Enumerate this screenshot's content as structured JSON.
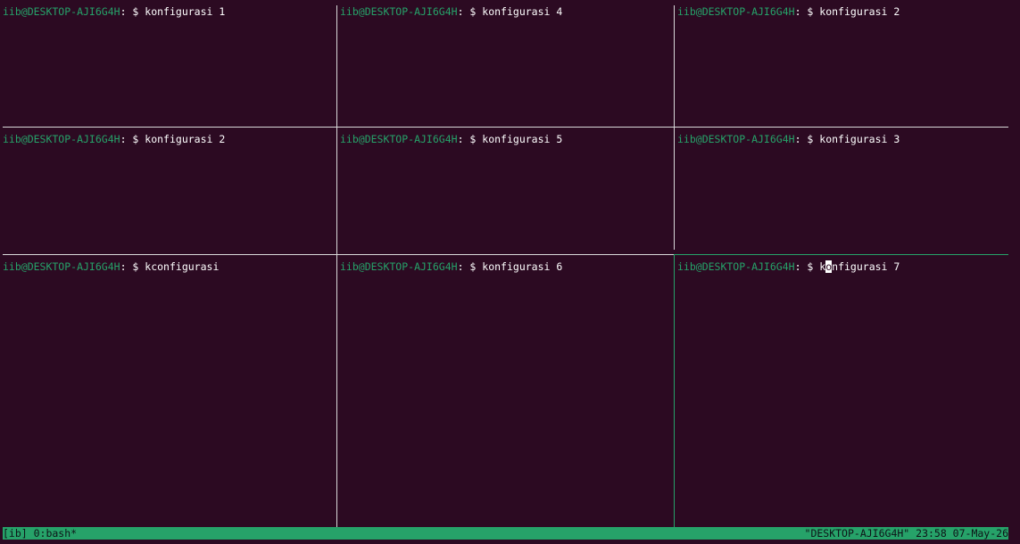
{
  "prompt": {
    "user_host": "iib@DESKTOP-AJI6G4H",
    "separator": ":",
    "symbol": " $ "
  },
  "panes": [
    {
      "command": "konfigurasi 1"
    },
    {
      "command": "konfigurasi 4"
    },
    {
      "command": "konfigurasi 2"
    },
    {
      "command": "konfigurasi 2"
    },
    {
      "command": "konfigurasi 5"
    },
    {
      "command": "konfigurasi 3"
    },
    {
      "command": "kconfigurasi"
    },
    {
      "command": "konfigurasi 6"
    },
    {
      "command_before_cursor": "k",
      "cursor_char": "o",
      "command_after_cursor": "nfigurasi 7"
    }
  ],
  "statusbar": {
    "session": "[ib] 0:bash*",
    "right": "\"DESKTOP-AJI6G4H\" 23:58 07-May-26"
  },
  "colors": {
    "background": "#2c0a22",
    "prompt_user": "#26a269",
    "statusbar_bg": "#26a269",
    "pane_border": "#d9d9d9",
    "active_border": "#26a269"
  }
}
